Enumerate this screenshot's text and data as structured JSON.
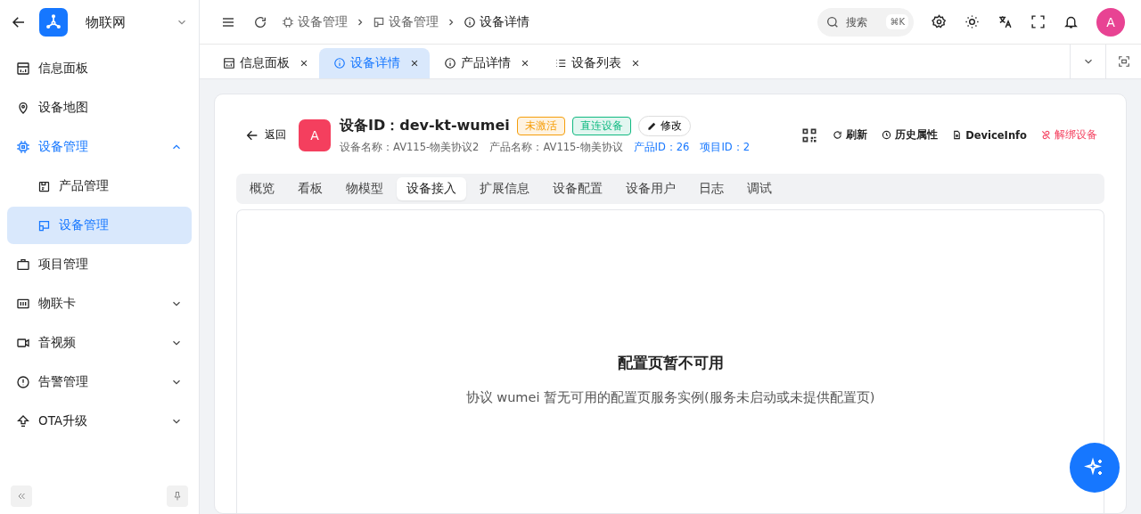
{
  "sidebar": {
    "title": "物联网",
    "items": [
      {
        "label": "信息面板",
        "selected": false,
        "active": false
      },
      {
        "label": "设备地图",
        "selected": false,
        "active": false
      },
      {
        "label": "设备管理",
        "selected": false,
        "active": true,
        "expanded": true,
        "children": [
          {
            "label": "产品管理",
            "selected": false
          },
          {
            "label": "设备管理",
            "selected": true
          }
        ]
      },
      {
        "label": "项目管理",
        "selected": false,
        "active": false
      },
      {
        "label": "物联卡",
        "selected": false,
        "active": false,
        "expanded": false
      },
      {
        "label": "音视频",
        "selected": false,
        "active": false,
        "expanded": false
      },
      {
        "label": "告警管理",
        "selected": false,
        "active": false,
        "expanded": false
      },
      {
        "label": "OTA升级",
        "selected": false,
        "active": false,
        "expanded": false
      }
    ]
  },
  "breadcrumb": [
    "设备管理",
    "设备管理",
    "设备详情"
  ],
  "search": {
    "placeholder": "搜索",
    "shortcut": "⌘K"
  },
  "user": {
    "avatar": "A"
  },
  "tabs": [
    {
      "label": "信息面板",
      "selected": false
    },
    {
      "label": "设备详情",
      "selected": true
    },
    {
      "label": "产品详情",
      "selected": false
    },
    {
      "label": "设备列表",
      "selected": false
    }
  ],
  "device": {
    "back": "返回",
    "avatar": "A",
    "title": "设备ID：dev-kt-wumei",
    "badges": [
      {
        "label": "未激活",
        "color": "#f59e0b"
      },
      {
        "label": "直连设备",
        "color": "#10b981"
      }
    ],
    "edit": "修改",
    "meta": [
      {
        "text": "设备名称：AV115-物美协议2",
        "kind": "plain"
      },
      {
        "text": "产品名称：AV115-物美协议",
        "kind": "plain"
      },
      {
        "text": "产品ID：26",
        "kind": "link"
      },
      {
        "text": "项目ID：2",
        "kind": "link"
      }
    ],
    "actions": [
      {
        "label": "刷新",
        "kind": "normal"
      },
      {
        "label": "历史属性",
        "kind": "normal"
      },
      {
        "label": "DeviceInfo",
        "kind": "normal"
      },
      {
        "label": "解绑设备",
        "kind": "danger"
      }
    ]
  },
  "subtabs": [
    {
      "label": "概览",
      "selected": false
    },
    {
      "label": "看板",
      "selected": false
    },
    {
      "label": "物模型",
      "selected": false
    },
    {
      "label": "设备接入",
      "selected": true
    },
    {
      "label": "扩展信息",
      "selected": false
    },
    {
      "label": "设备配置",
      "selected": false
    },
    {
      "label": "设备用户",
      "selected": false
    },
    {
      "label": "日志",
      "selected": false
    },
    {
      "label": "调试",
      "selected": false
    }
  ],
  "empty": {
    "title": "配置页暂不可用",
    "message": "协议 wumei 暂无可用的配置页服务实例(服务未启动或未提供配置页)"
  }
}
